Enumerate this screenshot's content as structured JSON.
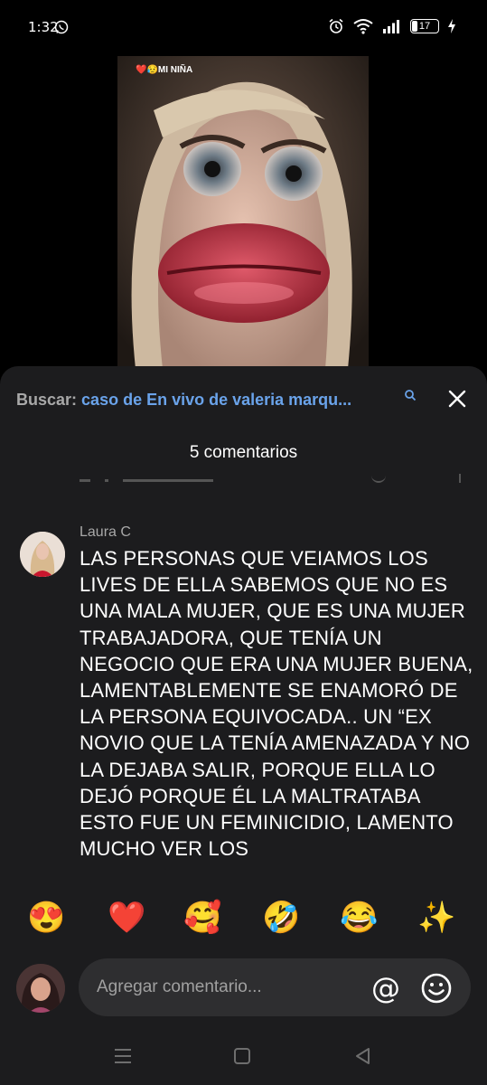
{
  "status": {
    "time": "1:32",
    "battery": "17"
  },
  "video": {
    "caption": "MI NIÑA"
  },
  "search": {
    "prefix": "Buscar:",
    "query": "caso de En vivo de valeria marqu..."
  },
  "comments": {
    "title": "5 comentarios",
    "item": {
      "author": "Laura C",
      "text": "LAS PERSONAS QUE VEIAMOS LOS LIVES DE ELLA SABEMOS QUE NO ES UNA MALA MUJER, QUE ES UNA MUJER TRABAJADORA, QUE TENÍA UN NEGOCIO QUE ERA UNA MUJER BUENA, LAMENTABLEMENTE SE ENAMORÓ DE LA PERSONA EQUIVOCADA.. UN “EX NOVIO QUE LA TENÍA AMENAZADA Y NO LA DEJABA SALIR, PORQUE ELLA LO DEJÓ PORQUE ÉL LA MALTRATABA ESTO FUE UN FEMINICIDIO, LAMENTO MUCHO VER LOS"
    }
  },
  "reactions": {
    "heart_eyes": "😍",
    "red_heart": "❤️",
    "smiling_hearts": "🥰",
    "rofl": "🤣",
    "joy": "😂",
    "sparkles": "✨"
  },
  "input": {
    "placeholder": "Agregar comentario...",
    "at_symbol": "@"
  },
  "icons": {
    "whatsapp": "whatsapp-icon",
    "alarm": "alarm-icon",
    "wifi": "wifi-icon",
    "signal": "signal-icon",
    "battery": "battery-icon",
    "charging": "charging-icon",
    "search_small": "search-icon",
    "close": "close-icon",
    "emoji": "emoji-icon",
    "nav_menu": "menu-icon",
    "nav_home": "home-icon",
    "nav_back": "back-icon"
  },
  "colors": {
    "sheet_bg": "#1c1c1e",
    "input_bg": "#2e2e30",
    "link_blue": "#6aa3ea",
    "muted_text": "#a8a8a8"
  }
}
